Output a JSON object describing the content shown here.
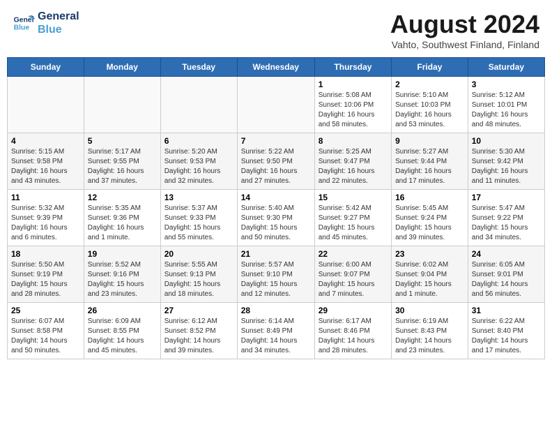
{
  "logo": {
    "line1": "General",
    "line2": "Blue"
  },
  "title": "August 2024",
  "location": "Vahto, Southwest Finland, Finland",
  "days_of_week": [
    "Sunday",
    "Monday",
    "Tuesday",
    "Wednesday",
    "Thursday",
    "Friday",
    "Saturday"
  ],
  "weeks": [
    [
      {
        "day": "",
        "info": ""
      },
      {
        "day": "",
        "info": ""
      },
      {
        "day": "",
        "info": ""
      },
      {
        "day": "",
        "info": ""
      },
      {
        "day": "1",
        "info": "Sunrise: 5:08 AM\nSunset: 10:06 PM\nDaylight: 16 hours\nand 58 minutes."
      },
      {
        "day": "2",
        "info": "Sunrise: 5:10 AM\nSunset: 10:03 PM\nDaylight: 16 hours\nand 53 minutes."
      },
      {
        "day": "3",
        "info": "Sunrise: 5:12 AM\nSunset: 10:01 PM\nDaylight: 16 hours\nand 48 minutes."
      }
    ],
    [
      {
        "day": "4",
        "info": "Sunrise: 5:15 AM\nSunset: 9:58 PM\nDaylight: 16 hours\nand 43 minutes."
      },
      {
        "day": "5",
        "info": "Sunrise: 5:17 AM\nSunset: 9:55 PM\nDaylight: 16 hours\nand 37 minutes."
      },
      {
        "day": "6",
        "info": "Sunrise: 5:20 AM\nSunset: 9:53 PM\nDaylight: 16 hours\nand 32 minutes."
      },
      {
        "day": "7",
        "info": "Sunrise: 5:22 AM\nSunset: 9:50 PM\nDaylight: 16 hours\nand 27 minutes."
      },
      {
        "day": "8",
        "info": "Sunrise: 5:25 AM\nSunset: 9:47 PM\nDaylight: 16 hours\nand 22 minutes."
      },
      {
        "day": "9",
        "info": "Sunrise: 5:27 AM\nSunset: 9:44 PM\nDaylight: 16 hours\nand 17 minutes."
      },
      {
        "day": "10",
        "info": "Sunrise: 5:30 AM\nSunset: 9:42 PM\nDaylight: 16 hours\nand 11 minutes."
      }
    ],
    [
      {
        "day": "11",
        "info": "Sunrise: 5:32 AM\nSunset: 9:39 PM\nDaylight: 16 hours\nand 6 minutes."
      },
      {
        "day": "12",
        "info": "Sunrise: 5:35 AM\nSunset: 9:36 PM\nDaylight: 16 hours\nand 1 minute."
      },
      {
        "day": "13",
        "info": "Sunrise: 5:37 AM\nSunset: 9:33 PM\nDaylight: 15 hours\nand 55 minutes."
      },
      {
        "day": "14",
        "info": "Sunrise: 5:40 AM\nSunset: 9:30 PM\nDaylight: 15 hours\nand 50 minutes."
      },
      {
        "day": "15",
        "info": "Sunrise: 5:42 AM\nSunset: 9:27 PM\nDaylight: 15 hours\nand 45 minutes."
      },
      {
        "day": "16",
        "info": "Sunrise: 5:45 AM\nSunset: 9:24 PM\nDaylight: 15 hours\nand 39 minutes."
      },
      {
        "day": "17",
        "info": "Sunrise: 5:47 AM\nSunset: 9:22 PM\nDaylight: 15 hours\nand 34 minutes."
      }
    ],
    [
      {
        "day": "18",
        "info": "Sunrise: 5:50 AM\nSunset: 9:19 PM\nDaylight: 15 hours\nand 28 minutes."
      },
      {
        "day": "19",
        "info": "Sunrise: 5:52 AM\nSunset: 9:16 PM\nDaylight: 15 hours\nand 23 minutes."
      },
      {
        "day": "20",
        "info": "Sunrise: 5:55 AM\nSunset: 9:13 PM\nDaylight: 15 hours\nand 18 minutes."
      },
      {
        "day": "21",
        "info": "Sunrise: 5:57 AM\nSunset: 9:10 PM\nDaylight: 15 hours\nand 12 minutes."
      },
      {
        "day": "22",
        "info": "Sunrise: 6:00 AM\nSunset: 9:07 PM\nDaylight: 15 hours\nand 7 minutes."
      },
      {
        "day": "23",
        "info": "Sunrise: 6:02 AM\nSunset: 9:04 PM\nDaylight: 15 hours\nand 1 minute."
      },
      {
        "day": "24",
        "info": "Sunrise: 6:05 AM\nSunset: 9:01 PM\nDaylight: 14 hours\nand 56 minutes."
      }
    ],
    [
      {
        "day": "25",
        "info": "Sunrise: 6:07 AM\nSunset: 8:58 PM\nDaylight: 14 hours\nand 50 minutes."
      },
      {
        "day": "26",
        "info": "Sunrise: 6:09 AM\nSunset: 8:55 PM\nDaylight: 14 hours\nand 45 minutes."
      },
      {
        "day": "27",
        "info": "Sunrise: 6:12 AM\nSunset: 8:52 PM\nDaylight: 14 hours\nand 39 minutes."
      },
      {
        "day": "28",
        "info": "Sunrise: 6:14 AM\nSunset: 8:49 PM\nDaylight: 14 hours\nand 34 minutes."
      },
      {
        "day": "29",
        "info": "Sunrise: 6:17 AM\nSunset: 8:46 PM\nDaylight: 14 hours\nand 28 minutes."
      },
      {
        "day": "30",
        "info": "Sunrise: 6:19 AM\nSunset: 8:43 PM\nDaylight: 14 hours\nand 23 minutes."
      },
      {
        "day": "31",
        "info": "Sunrise: 6:22 AM\nSunset: 8:40 PM\nDaylight: 14 hours\nand 17 minutes."
      }
    ]
  ]
}
